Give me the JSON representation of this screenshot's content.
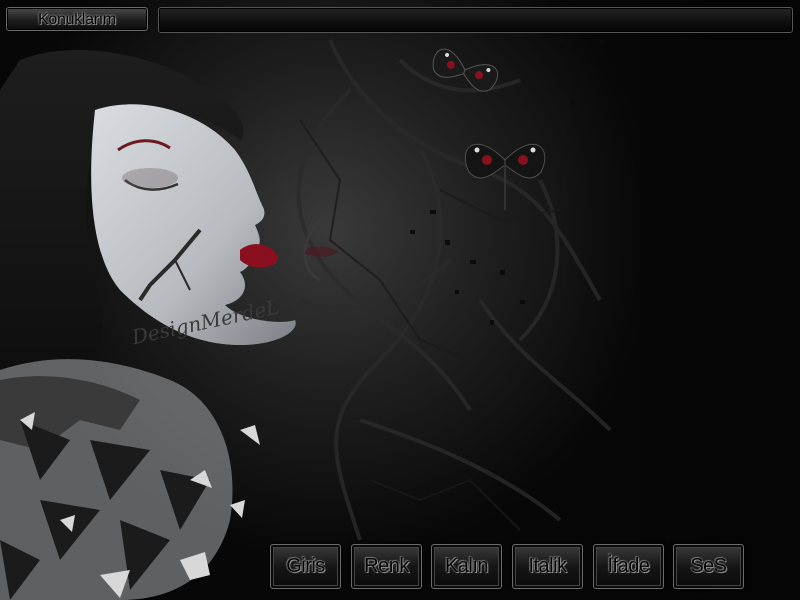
{
  "header": {
    "title": "Konuklarım",
    "message_input": {
      "value": "",
      "placeholder": ""
    }
  },
  "toolbar": {
    "buttons": [
      {
        "label": "Giris"
      },
      {
        "label": "Renk"
      },
      {
        "label": "Kalın"
      },
      {
        "label": "Italik"
      },
      {
        "label": "İfade"
      },
      {
        "label": "SeS"
      }
    ]
  },
  "artwork": {
    "signature": "DesignMerdeL"
  },
  "colors": {
    "background": "#070707",
    "skin": "#c9ccd0",
    "lips": "#8a1020",
    "panel_border": "#6b6b6b"
  }
}
